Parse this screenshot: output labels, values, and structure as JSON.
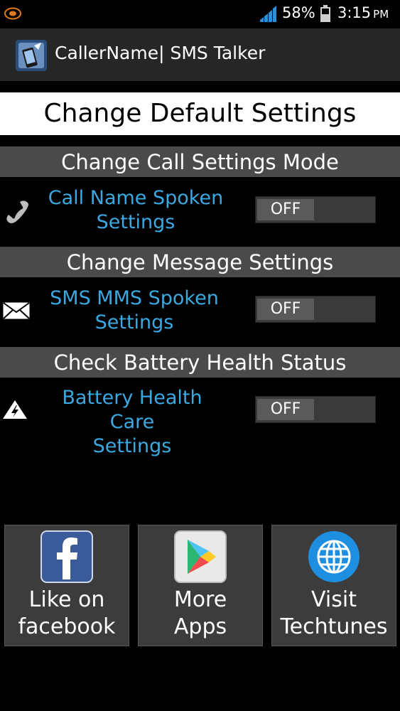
{
  "status_bar": {
    "battery_percent": "58%",
    "time": "3:15",
    "ampm": "PM"
  },
  "action_bar": {
    "title": "CallerName| SMS Talker"
  },
  "page": {
    "heading": "Change Default Settings"
  },
  "sections": [
    {
      "header": "Change Call Settings Mode",
      "icon": "phone-icon",
      "label_line1": "Call Name Spoken",
      "label_line2": "Settings",
      "toggle": "OFF"
    },
    {
      "header": "Change Message  Settings",
      "icon": "envelope-icon",
      "label_line1": "SMS MMS Spoken",
      "label_line2": "Settings",
      "toggle": "OFF"
    },
    {
      "header": "Check Battery Health Status",
      "icon": "battery-warning-icon",
      "label_line1": "Battery Health Care",
      "label_line2": "Settings",
      "toggle": "OFF"
    }
  ],
  "bottom_buttons": [
    {
      "icon": "facebook-icon",
      "line1": "Like on",
      "line2": "facebook"
    },
    {
      "icon": "play-store-icon",
      "line1": "More",
      "line2": "Apps"
    },
    {
      "icon": "globe-icon",
      "line1": "Visit",
      "line2": "Techtunes"
    }
  ],
  "colors": {
    "accent": "#3aa9e2",
    "section_header_bg": "#4a4a4a",
    "action_bar_bg": "#262626",
    "signal": "#2f8fd6"
  }
}
